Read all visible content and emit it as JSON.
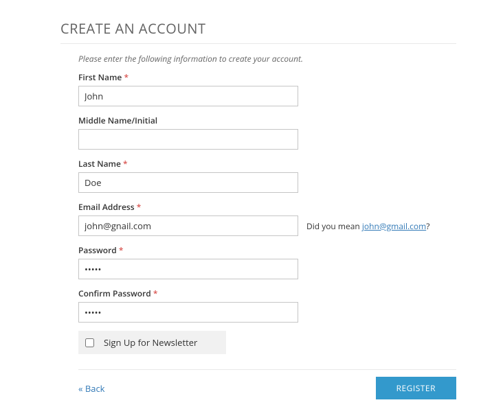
{
  "title": "CREATE AN ACCOUNT",
  "instructions": "Please enter the following information to create your account.",
  "fields": {
    "first_name": {
      "label": "First Name",
      "required": "*",
      "value": "John"
    },
    "middle_name": {
      "label": "Middle Name/Initial",
      "value": ""
    },
    "last_name": {
      "label": "Last Name",
      "required": "*",
      "value": "Doe"
    },
    "email": {
      "label": "Email Address",
      "required": "*",
      "value": "john@gnail.com"
    },
    "password": {
      "label": "Password",
      "required": "*",
      "value": "•••••"
    },
    "confirm_password": {
      "label": "Confirm Password",
      "required": "*",
      "value": "•••••"
    }
  },
  "email_suggestion": {
    "prefix": "Did you mean ",
    "link": "john@gmail.com",
    "suffix": "?"
  },
  "newsletter": {
    "label": "Sign Up for Newsletter",
    "checked": false
  },
  "actions": {
    "back": "« Back",
    "register": "REGISTER"
  }
}
